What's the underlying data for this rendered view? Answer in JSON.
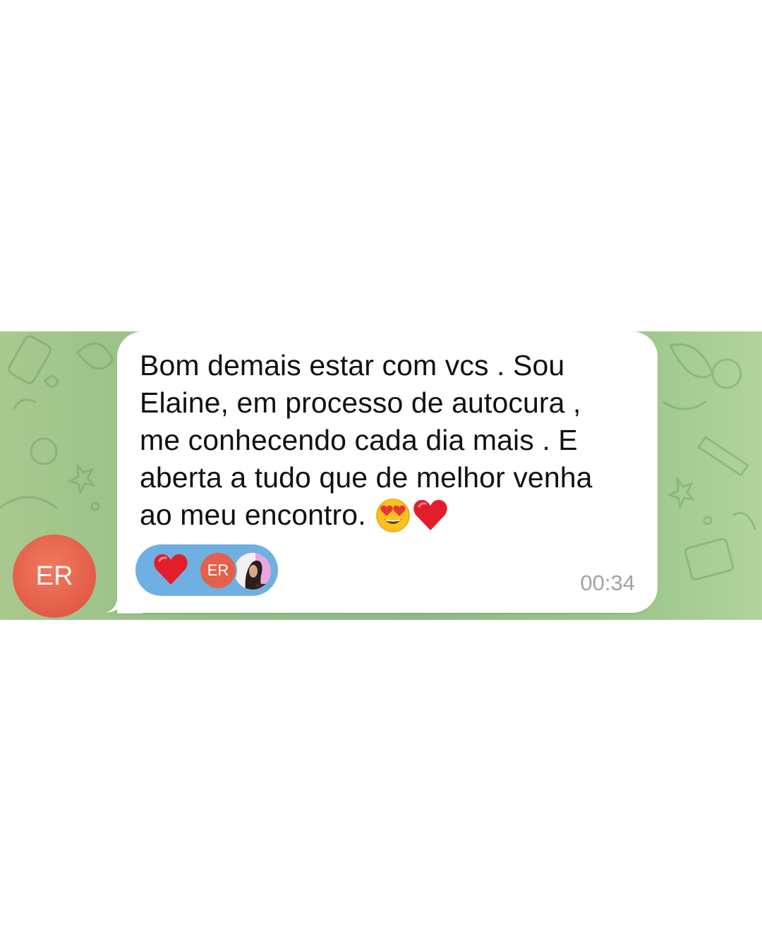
{
  "chat": {
    "sender": {
      "initials": "ER",
      "avatar_color": "#e4604a"
    },
    "message": {
      "lines": [
        "Bom demais estar com vcs . Sou",
        "Elaine, em processo de autocura ,",
        "me conhecendo cada dia mais . E",
        "aberta a tudo que de melhor venha",
        "ao meu encontro."
      ],
      "trailing_emojis": [
        "heart-eyes-emoji",
        "red-heart-emoji"
      ],
      "time": "00:34"
    },
    "reaction": {
      "emoji": "red-heart-emoji",
      "reactor_initials": "ER",
      "pill_color": "#6fb0e2"
    },
    "background_color": "#93bf86"
  }
}
